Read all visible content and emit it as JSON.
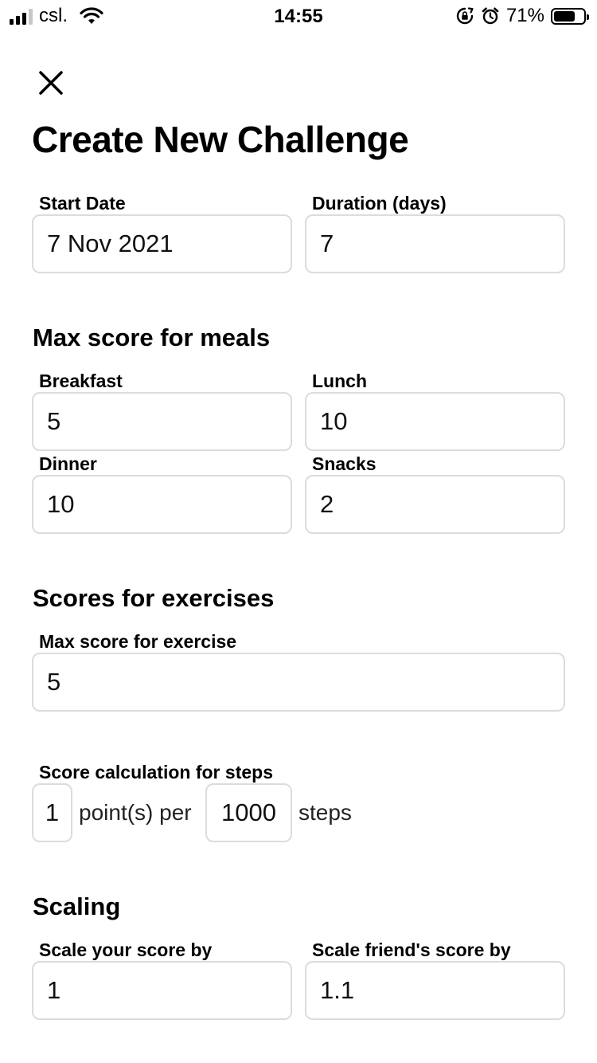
{
  "status_bar": {
    "carrier": "csl.",
    "time": "14:55",
    "battery_percent": "71%",
    "battery_level": 0.71,
    "icons": [
      "signal-icon",
      "wifi-icon",
      "rotation-lock-icon",
      "alarm-icon",
      "battery-icon"
    ]
  },
  "header": {
    "close_icon": "close-icon",
    "title": "Create New Challenge"
  },
  "schedule": {
    "start_date_label": "Start Date",
    "start_date_value": "7 Nov 2021",
    "duration_label": "Duration (days)",
    "duration_value": "7"
  },
  "meals": {
    "section_title": "Max score for meals",
    "breakfast_label": "Breakfast",
    "breakfast_value": "5",
    "lunch_label": "Lunch",
    "lunch_value": "10",
    "dinner_label": "Dinner",
    "dinner_value": "10",
    "snacks_label": "Snacks",
    "snacks_value": "2"
  },
  "exercises": {
    "section_title": "Scores for exercises",
    "max_exercise_label": "Max score for exercise",
    "max_exercise_value": "5",
    "steps_label": "Score calculation for steps",
    "points_value": "1",
    "points_text": "point(s) per",
    "steps_value": "1000",
    "steps_text": "steps"
  },
  "scaling": {
    "section_title": "Scaling",
    "your_label": "Scale your score by",
    "your_value": "1",
    "friend_label": "Scale friend's score by",
    "friend_value": "1.1"
  }
}
